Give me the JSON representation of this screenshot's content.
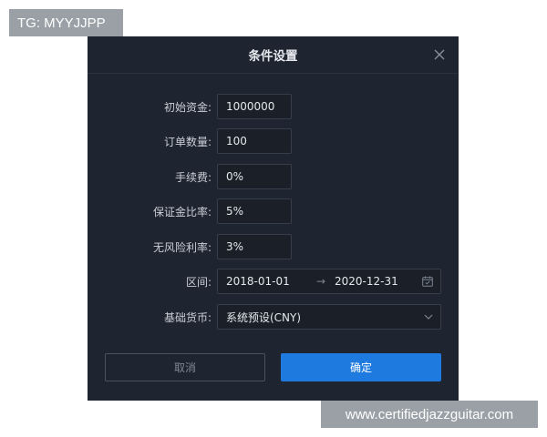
{
  "watermark_top": "TG: MYYJJPP",
  "watermark_bottom": "www.certifiedjazzguitar.com",
  "dialog": {
    "title": "条件设置",
    "fields": {
      "initial_capital": {
        "label": "初始资金:",
        "value": "1000000"
      },
      "order_quantity": {
        "label": "订单数量:",
        "value": "100"
      },
      "commission": {
        "label": "手续费:",
        "value": "0%"
      },
      "margin_ratio": {
        "label": "保证金比率:",
        "value": "5%"
      },
      "risk_free_rate": {
        "label": "无风险利率:",
        "value": "3%"
      },
      "interval": {
        "label": "区间:",
        "start": "2018-01-01",
        "separator": "→",
        "end": "2020-12-31"
      },
      "base_currency": {
        "label": "基础货币:",
        "value": "系统预设(CNY)"
      }
    },
    "buttons": {
      "cancel": "取消",
      "confirm": "确定"
    }
  },
  "icons": {
    "close": "close-icon",
    "calendar": "calendar-icon",
    "dropdown": "chevron-down-icon"
  },
  "colors": {
    "dialog_bg": "#1f2530",
    "primary": "#1f7ae0"
  }
}
